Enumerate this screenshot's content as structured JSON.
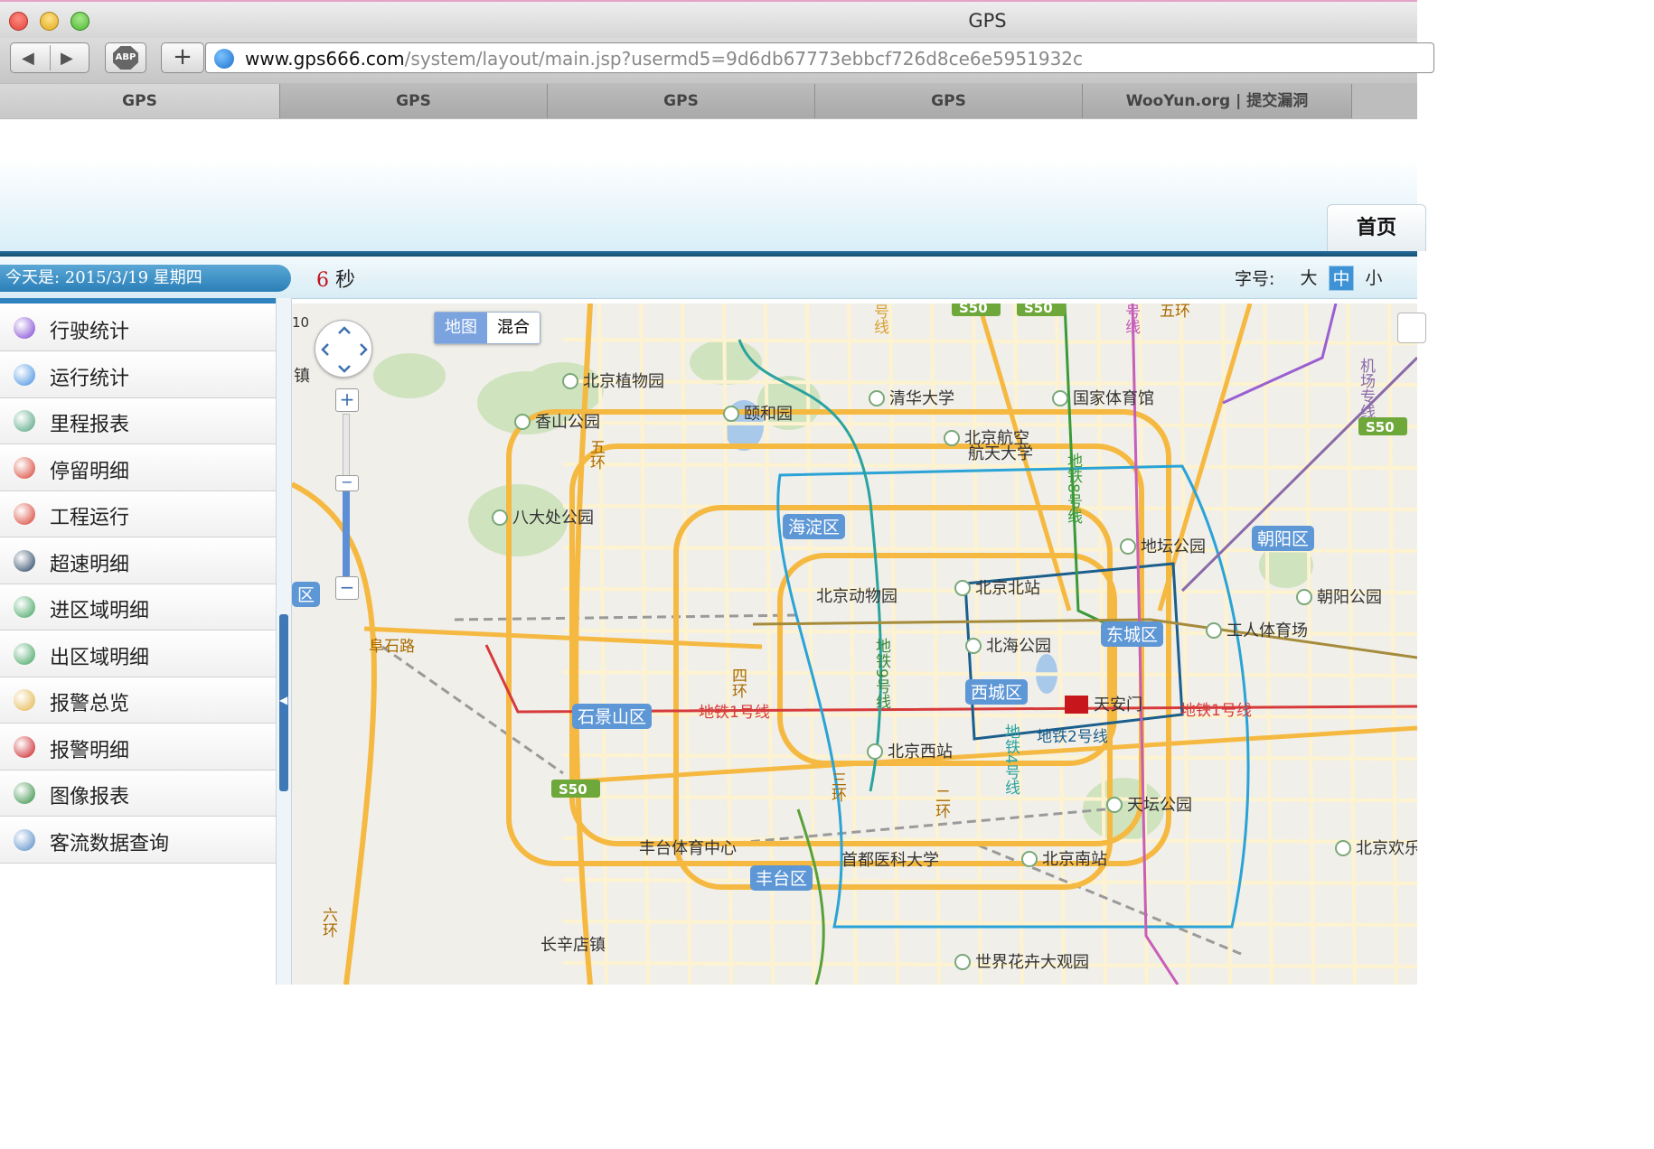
{
  "window": {
    "title": "GPS"
  },
  "toolbar": {
    "url_host": "www.gps666.com",
    "url_path": "/system/layout/main.jsp?usermd5=9d6db67773ebbcf726d8ce6e5951932c",
    "abp_label": "ABP",
    "back_icon": "◀",
    "forward_icon": "▶",
    "new_tab_icon": "+"
  },
  "tabs": [
    {
      "label": "GPS"
    },
    {
      "label": "GPS"
    },
    {
      "label": "GPS"
    },
    {
      "label": "GPS"
    },
    {
      "label": "WooYun.org | 提交漏洞"
    }
  ],
  "header": {
    "home_label": "首页"
  },
  "infobar": {
    "date_text": "今天是:  2015/3/19 星期四",
    "countdown_value": "6",
    "countdown_unit": "秒",
    "font_label": "字号:",
    "font_large": "大",
    "font_medium": "中",
    "font_small": "小"
  },
  "sidebar": {
    "items": [
      {
        "label": "行驶统计",
        "color": "#7a3fd1"
      },
      {
        "label": "运行统计",
        "color": "#3c8be0"
      },
      {
        "label": "里程报表",
        "color": "#4aa07a"
      },
      {
        "label": "停留明细",
        "color": "#d53a2a"
      },
      {
        "label": "工程运行",
        "color": "#d53a2a"
      },
      {
        "label": "超速明细",
        "color": "#1d3c5a"
      },
      {
        "label": "进区域明细",
        "color": "#3aa05a"
      },
      {
        "label": "出区域明细",
        "color": "#3aa05a"
      },
      {
        "label": "报警总览",
        "color": "#e3b343"
      },
      {
        "label": "报警明细",
        "color": "#c8161d"
      },
      {
        "label": "图像报表",
        "color": "#2d8a3c"
      },
      {
        "label": "客流数据查询",
        "color": "#4f86c6"
      }
    ]
  },
  "map": {
    "type_map": "地图",
    "type_hybrid": "混合",
    "zoom_in": "+",
    "zoom_out": "−",
    "districts": [
      "海淀区",
      "朝阳区",
      "东城区",
      "西城区",
      "石景山区",
      "丰台区",
      "区"
    ],
    "pois": [
      "北京植物园",
      "颐和园",
      "香山公园",
      "清华大学",
      "国家体育馆",
      "北京航空",
      "航天大学",
      "八大处公园",
      "地坛公园",
      "北京北站",
      "北京动物园",
      "朝阳公园",
      "北海公园",
      "工人体育场",
      "天安门",
      "北京西站",
      "天坛公园",
      "丰台体育中心",
      "首都医科大学",
      "北京南站",
      "北京欢乐",
      "长辛店镇",
      "世界花卉大观园",
      "镇"
    ],
    "lines": [
      "地铁1号线",
      "地铁2号线",
      "地铁4号线",
      "地铁8号线",
      "地铁9号线",
      "号线",
      "号线",
      "机场专线"
    ],
    "roads": [
      "阜石路",
      "四环",
      "五环",
      "三环",
      "二环",
      "六环",
      "S50",
      "S50",
      "S50",
      "S50",
      "五环",
      "10"
    ]
  },
  "colors": {
    "accent": "#2a7fb7",
    "road": "#f5b942",
    "line1": "#d63a3a",
    "line2": "#1b5e8c",
    "line4": "#2aa39e",
    "line8": "#3a9a3a",
    "line9": "#8ab83a"
  }
}
